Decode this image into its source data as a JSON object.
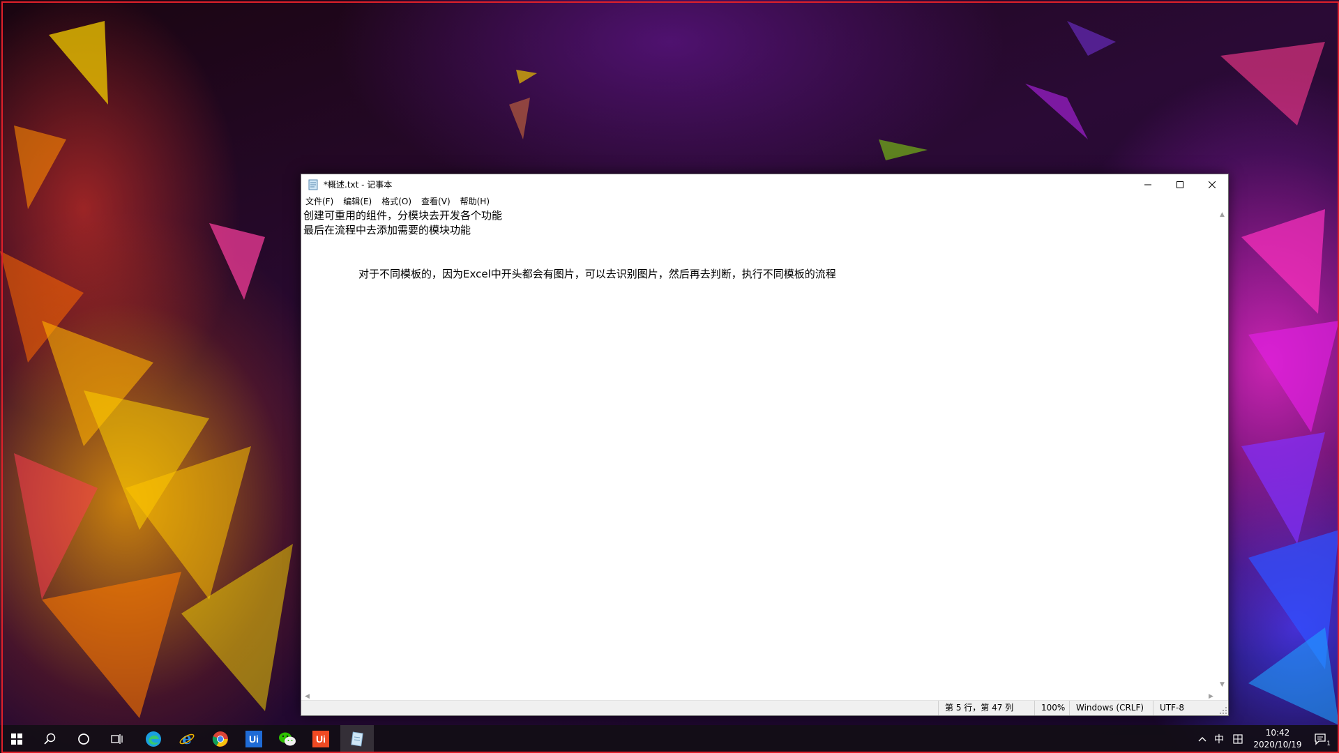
{
  "window": {
    "title": "*概述.txt - 记事本"
  },
  "menu": {
    "items": [
      "文件(F)",
      "编辑(E)",
      "格式(O)",
      "查看(V)",
      "帮助(H)"
    ]
  },
  "editor": {
    "lines": [
      "创建可重用的组件，分模块去开发各个功能",
      "最后在流程中去添加需要的模块功能",
      "",
      "",
      "对于不同模板的，因为Excel中开头都会有图片，可以去识别图片，然后再去判断，执行不同模板的流程"
    ]
  },
  "statusbar": {
    "position": "第 5 行，第 47 列",
    "zoom": "100%",
    "line_ending": "Windows (CRLF)",
    "encoding": "UTF-8"
  },
  "taskbar": {
    "items": [
      {
        "name": "start",
        "icon": "windows-logo-icon"
      },
      {
        "name": "search",
        "icon": "search-icon"
      },
      {
        "name": "cortana",
        "icon": "circle-icon"
      },
      {
        "name": "task-view",
        "icon": "task-view-icon"
      },
      {
        "name": "edge",
        "icon": "edge-icon"
      },
      {
        "name": "ie",
        "icon": "internet-explorer-icon"
      },
      {
        "name": "chrome",
        "icon": "chrome-icon"
      },
      {
        "name": "uipath-studio",
        "icon": "uipath-blue-icon",
        "label": "Ui"
      },
      {
        "name": "wechat",
        "icon": "wechat-icon"
      },
      {
        "name": "uipath-robot",
        "icon": "uipath-orange-icon",
        "label": "Ui"
      },
      {
        "name": "notepad",
        "icon": "notepad-icon"
      }
    ],
    "tray": {
      "ime_language": "中",
      "time": "10:42",
      "date": "2020/10/19",
      "notification_count": "1"
    }
  },
  "colors": {
    "uipath_blue": "#1f6bd6",
    "uipath_orange": "#f04a23",
    "frame_red": "#e0202a"
  }
}
